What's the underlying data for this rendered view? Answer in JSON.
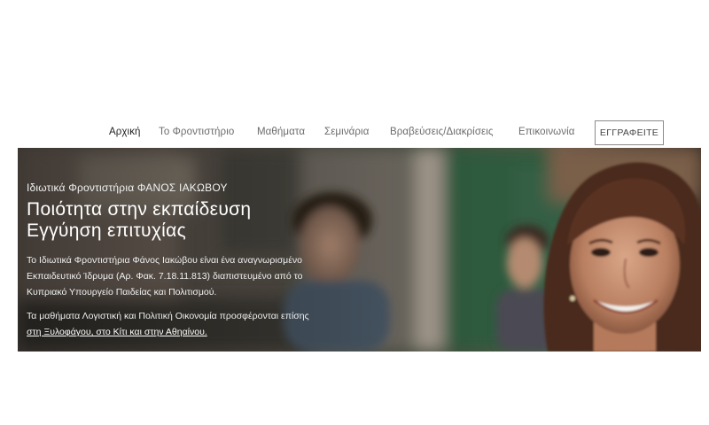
{
  "nav": {
    "items": [
      {
        "label": "Αρχική",
        "active": true
      },
      {
        "label": "Το Φροντιστήριο",
        "active": false
      },
      {
        "label": "Μαθήματα",
        "active": false
      },
      {
        "label": "Σεμινάρια",
        "active": false
      },
      {
        "label": "Βραβεύσεις/Διακρίσεις",
        "active": false
      },
      {
        "label": "Επικοινωνία",
        "active": false
      }
    ],
    "cta_label": "ΕΓΓΡΑΦΕΙΤΕ"
  },
  "hero": {
    "kicker": "Ιδιωτικά Φροντιστήρια ΦΑΝΟΣ ΙΑΚΩΒΟΥ",
    "title_line1": "Ποιότητα στην εκπαίδευση",
    "title_line2": "Εγγύηση επιτυχίας",
    "description_lines": [
      "Το Ιδιωτικά Φροντιστήρια Φάνος Ιακώβου είναι ένα αναγνωρισμένο",
      "Εκπαιδευτικό Ίδρυμα (Αρ. Φακ. 7.18.11.813) διαπιστευμένο από το",
      "Κυπριακό Υπουργείο Παιδείας και Πολιτισμού."
    ],
    "courses_line": "Τα μαθήματα Λογιστική και Πολιτική Οικονομία προσφέρονται επίσης",
    "locations_link": "στη Ξυλοφάγου, στο Κίτι και στην Αθηαίνου."
  }
}
